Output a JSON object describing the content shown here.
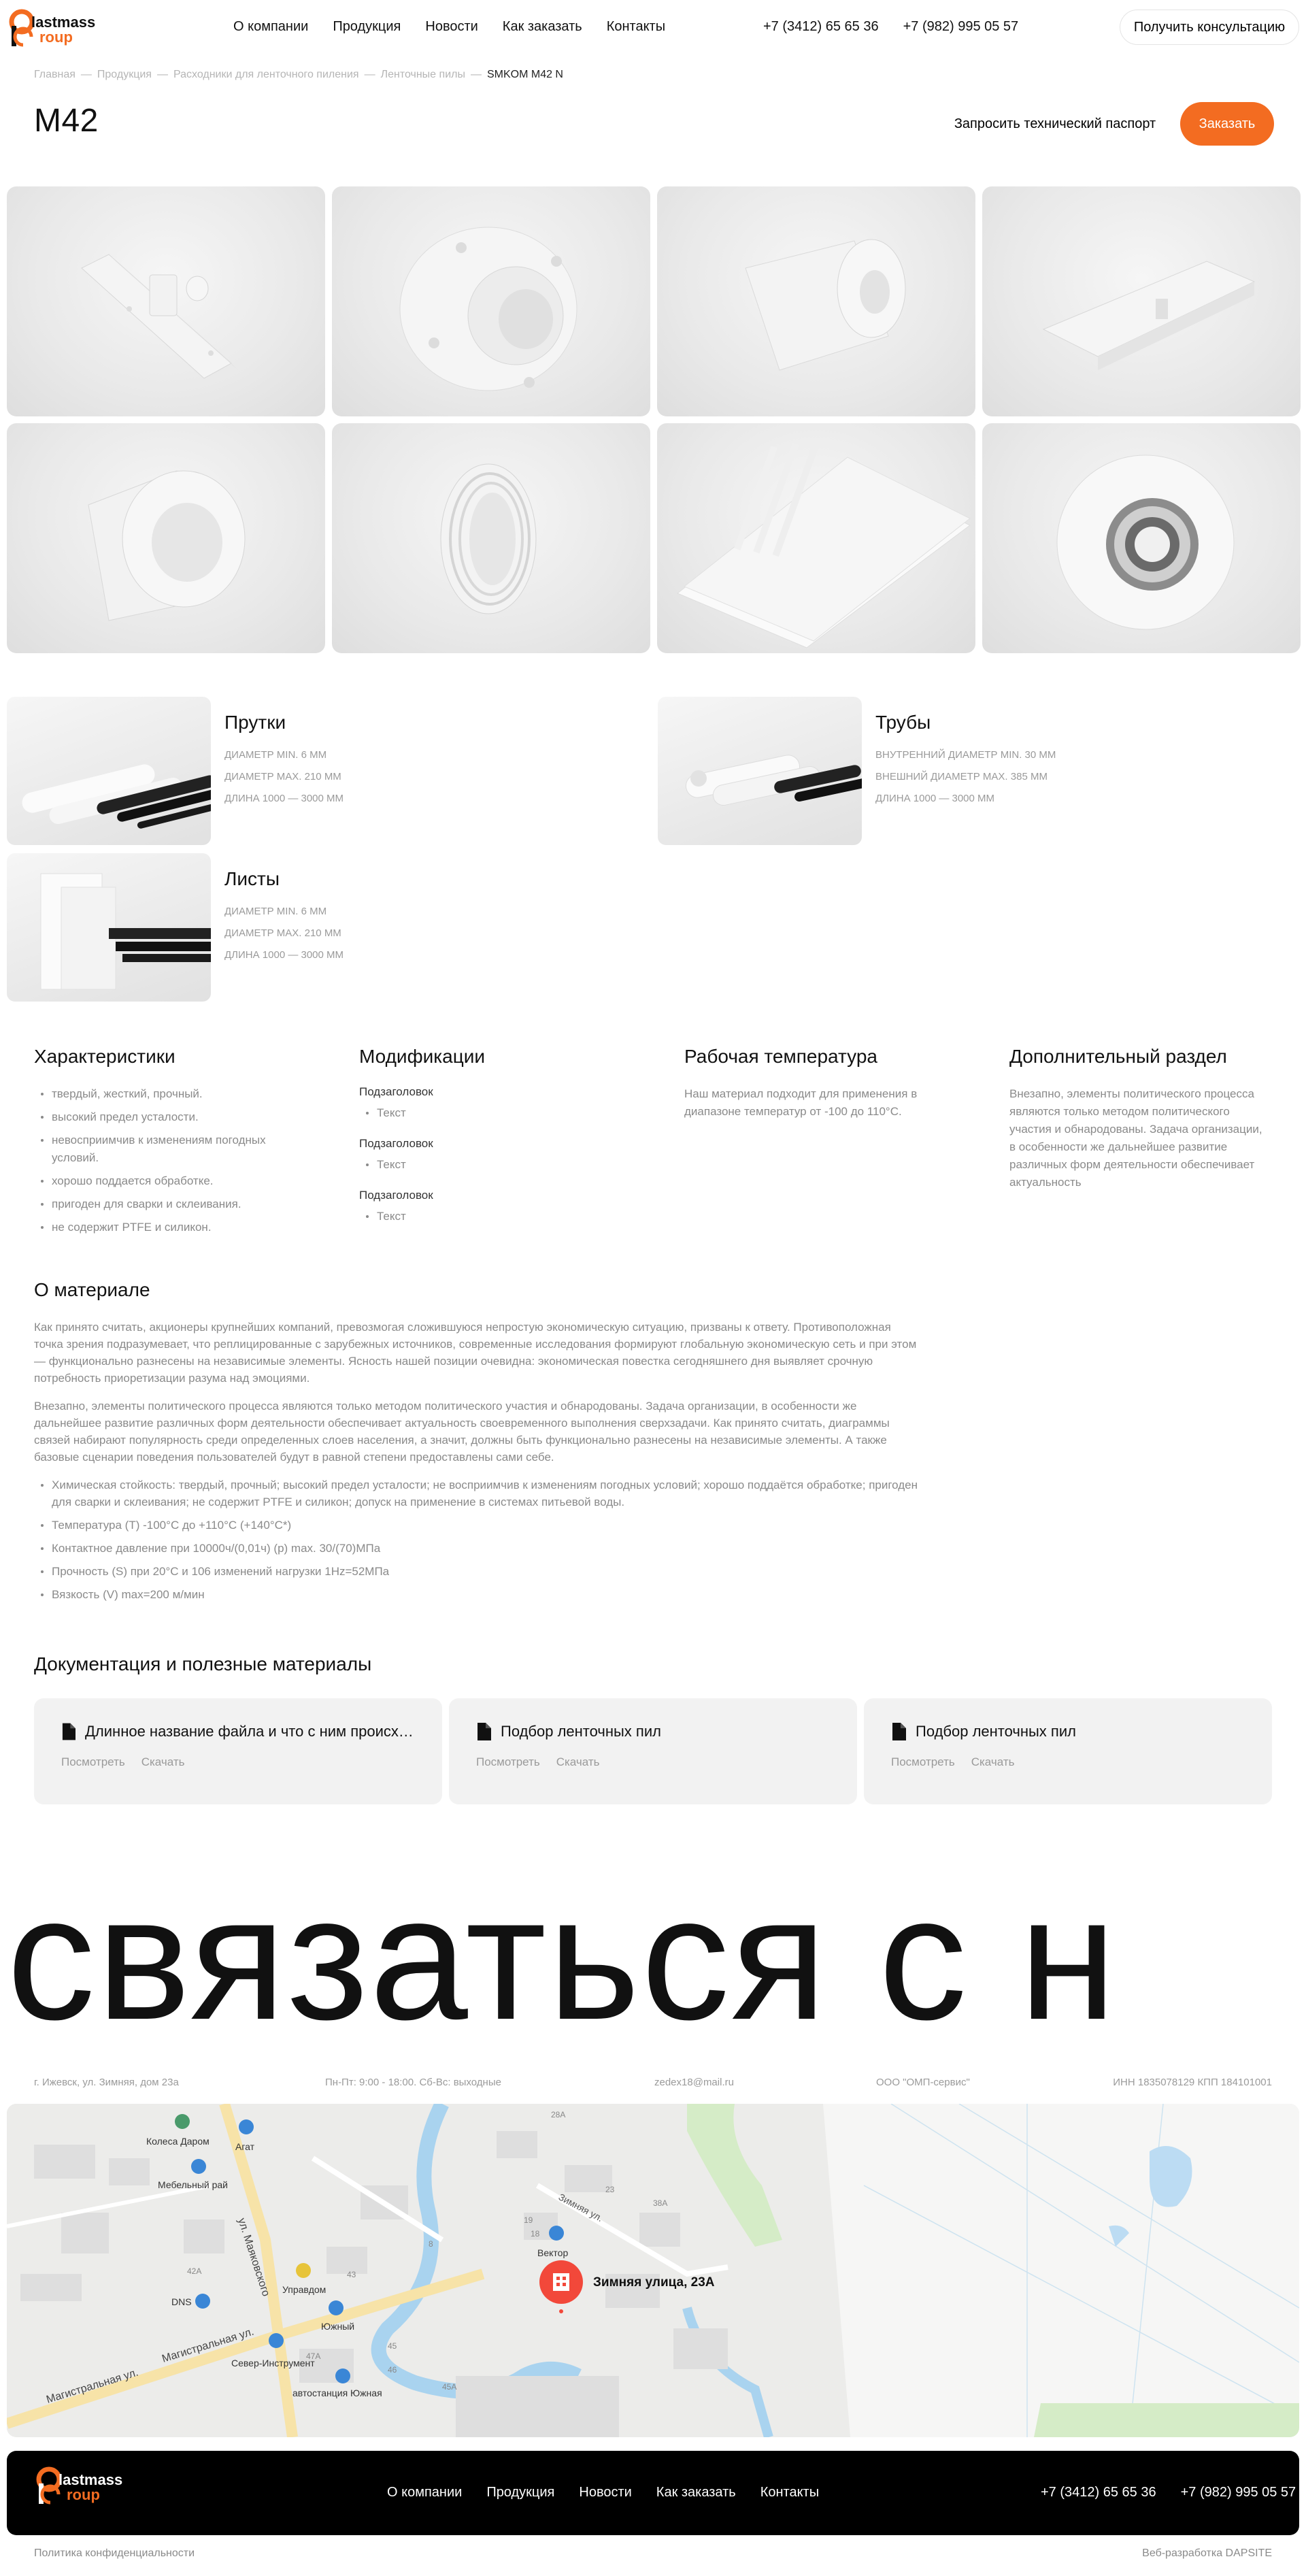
{
  "brand": {
    "logo_part1": "lastmass",
    "logo_part2": "roup",
    "accent": "#f36c21"
  },
  "nav": [
    "О компании",
    "Продукция",
    "Новости",
    "Как заказать",
    "Контакты"
  ],
  "phones": [
    "+7 (3412) 65 65 36",
    "+7 (982) 995 05 57"
  ],
  "header": {
    "consult_label": "Получить консультацию"
  },
  "breadcrumbs": [
    "Главная",
    "—",
    "Продукция",
    "—",
    "Расходники для ленточного пиления",
    "—",
    "Ленточные пилы",
    "—",
    "SMKOM M42 N"
  ],
  "title": "М42",
  "actions": {
    "passport": "Запросить технический паспорт",
    "order": "Заказать"
  },
  "gallery_icons": [
    "bracket-part-image",
    "flange-part-image",
    "bushing-part-image",
    "profile-part-image",
    "sleeve-part-image",
    "ring-part-image",
    "sheets-image",
    "roller-image"
  ],
  "forms": [
    {
      "title": "Прутки",
      "lines": [
        "ДИАМЕТР min. 6 мм",
        "ДИАМЕТР max. 210 мм",
        "ДЛИНА 1000 — 3000 мм"
      ]
    },
    {
      "title": "Трубы",
      "lines": [
        "ВНУТРЕННИЙ ДИАМЕТР min. 30 мм",
        "ВНЕШНИЙ ДИАМЕТР max. 385 мм",
        "ДЛИНА 1000 — 3000 мм"
      ]
    },
    {
      "title": "Листы",
      "lines": [
        "ДИАМЕТР min. 6 мм",
        "ДИАМЕТР max. 210 мм",
        "ДЛИНА 1000 — 3000 мм"
      ]
    }
  ],
  "specs": {
    "characteristics": {
      "title": "Характеристики",
      "items": [
        "твердый, жесткий, прочный.",
        "высокий предел усталости.",
        "невосприимчив к изменениям погодных условий.",
        "хорошо поддается обработке.",
        "пригоден для сварки и склеивания.",
        "не содержит PTFE и силикон."
      ]
    },
    "modifications": {
      "title": "Модификации",
      "groups": [
        {
          "sub": "Подзаголовок",
          "item": "Текст"
        },
        {
          "sub": "Подзаголовок",
          "item": "Текст"
        },
        {
          "sub": "Подзаголовок",
          "item": "Текст"
        }
      ]
    },
    "temperature": {
      "title": "Рабочая температура",
      "text": "Наш материал подходит для применения в диапазоне температур от -100 до 110°С."
    },
    "extra": {
      "title": "Дополнительный раздел",
      "text": "Внезапно, элементы политического процесса являются только методом политического участия и обнародованы. Задача организации, в особенности же дальнейшее развитие различных форм деятельности обеспечивает актуальность"
    }
  },
  "about": {
    "title": "О материале",
    "p1": "Как принято считать, акционеры крупнейших компаний, превозмогая сложившуюся непростую экономическую ситуацию, призваны к ответу. Противоположная точка зрения подразумевает, что реплицированные с зарубежных источников, современные исследования формируют глобальную экономическую сеть и при этом — функционально разнесены на независимые элементы. Ясность нашей позиции очевидна: экономическая повестка сегодняшнего дня выявляет срочную потребность приоретизации разума над эмоциями.",
    "p2": "Внезапно, элементы политического процесса являются только методом политического участия и обнародованы. Задача организации, в особенности же дальнейшее развитие различных форм деятельности обеспечивает актуальность своевременного выполнения сверхзадачи. Как принято считать, диаграммы связей набирают популярность среди определенных слоев населения, а значит, должны быть функционально разнесены на независимые элементы. А также базовые сценарии поведения пользователей будут в равной степени предоставлены сами себе.",
    "items": [
      "Химическая стойкость: твердый, прочный; высокий предел усталости; не восприимчив к изменениям погодных условий; хорошо поддаётся обработке; пригоден для сварки и склеивания; не содержит PTFE и силикон; допуск на применение в системах питьевой воды.",
      "Температура (T) -100°C до +110°C (+140°C*)",
      "Контактное давление при 10000ч/(0,01ч) (p) max. 30/(70)МПа",
      "Прочность (S) при 20°C и 106 изменений нагрузки 1Hz=52МПа",
      "Вязкость (V) max=200 м/мин"
    ]
  },
  "docs": {
    "title": "Документация и полезные материалы",
    "items": [
      {
        "name": "Длинное название файла и что с ним происходит",
        "view": "Посмотреть",
        "download": "Скачать"
      },
      {
        "name": "Подбор ленточных пил",
        "view": "Посмотреть",
        "download": "Скачать"
      },
      {
        "name": "Подбор ленточных пил",
        "view": "Посмотреть",
        "download": "Скачать"
      }
    ]
  },
  "big_text": "связаться с н",
  "contacts": {
    "address": "г. Ижевск, ул. Зимняя, дом 23а",
    "hours": "Пн-Пт: 9:00 - 18:00. Сб-Вс: выходные",
    "email": "zedex18@mail.ru",
    "company": "ООО \"ОМП-сервис\"",
    "inn": "ИНН 1835078129 КПП 184101001"
  },
  "map": {
    "marker_label": "Зимняя улица, 23А",
    "pois": [
      "Колеса Даром",
      "Агат",
      "Мебельный рай",
      "DNS",
      "Управдом",
      "Вектор",
      "Южный",
      "Север-Инструмент",
      "автостанция Южная"
    ],
    "streets": [
      "Магистральная ул.",
      "ул. Маяковского",
      "Зимняя ул."
    ],
    "house_numbers": [
      "28А",
      "23",
      "19",
      "38А",
      "18",
      "42А",
      "43",
      "46",
      "47А",
      "45А",
      "45",
      "8"
    ]
  },
  "footer": {
    "privacy": "Политика конфиденциальности",
    "dev": "Веб-разработка DAPSITE"
  }
}
